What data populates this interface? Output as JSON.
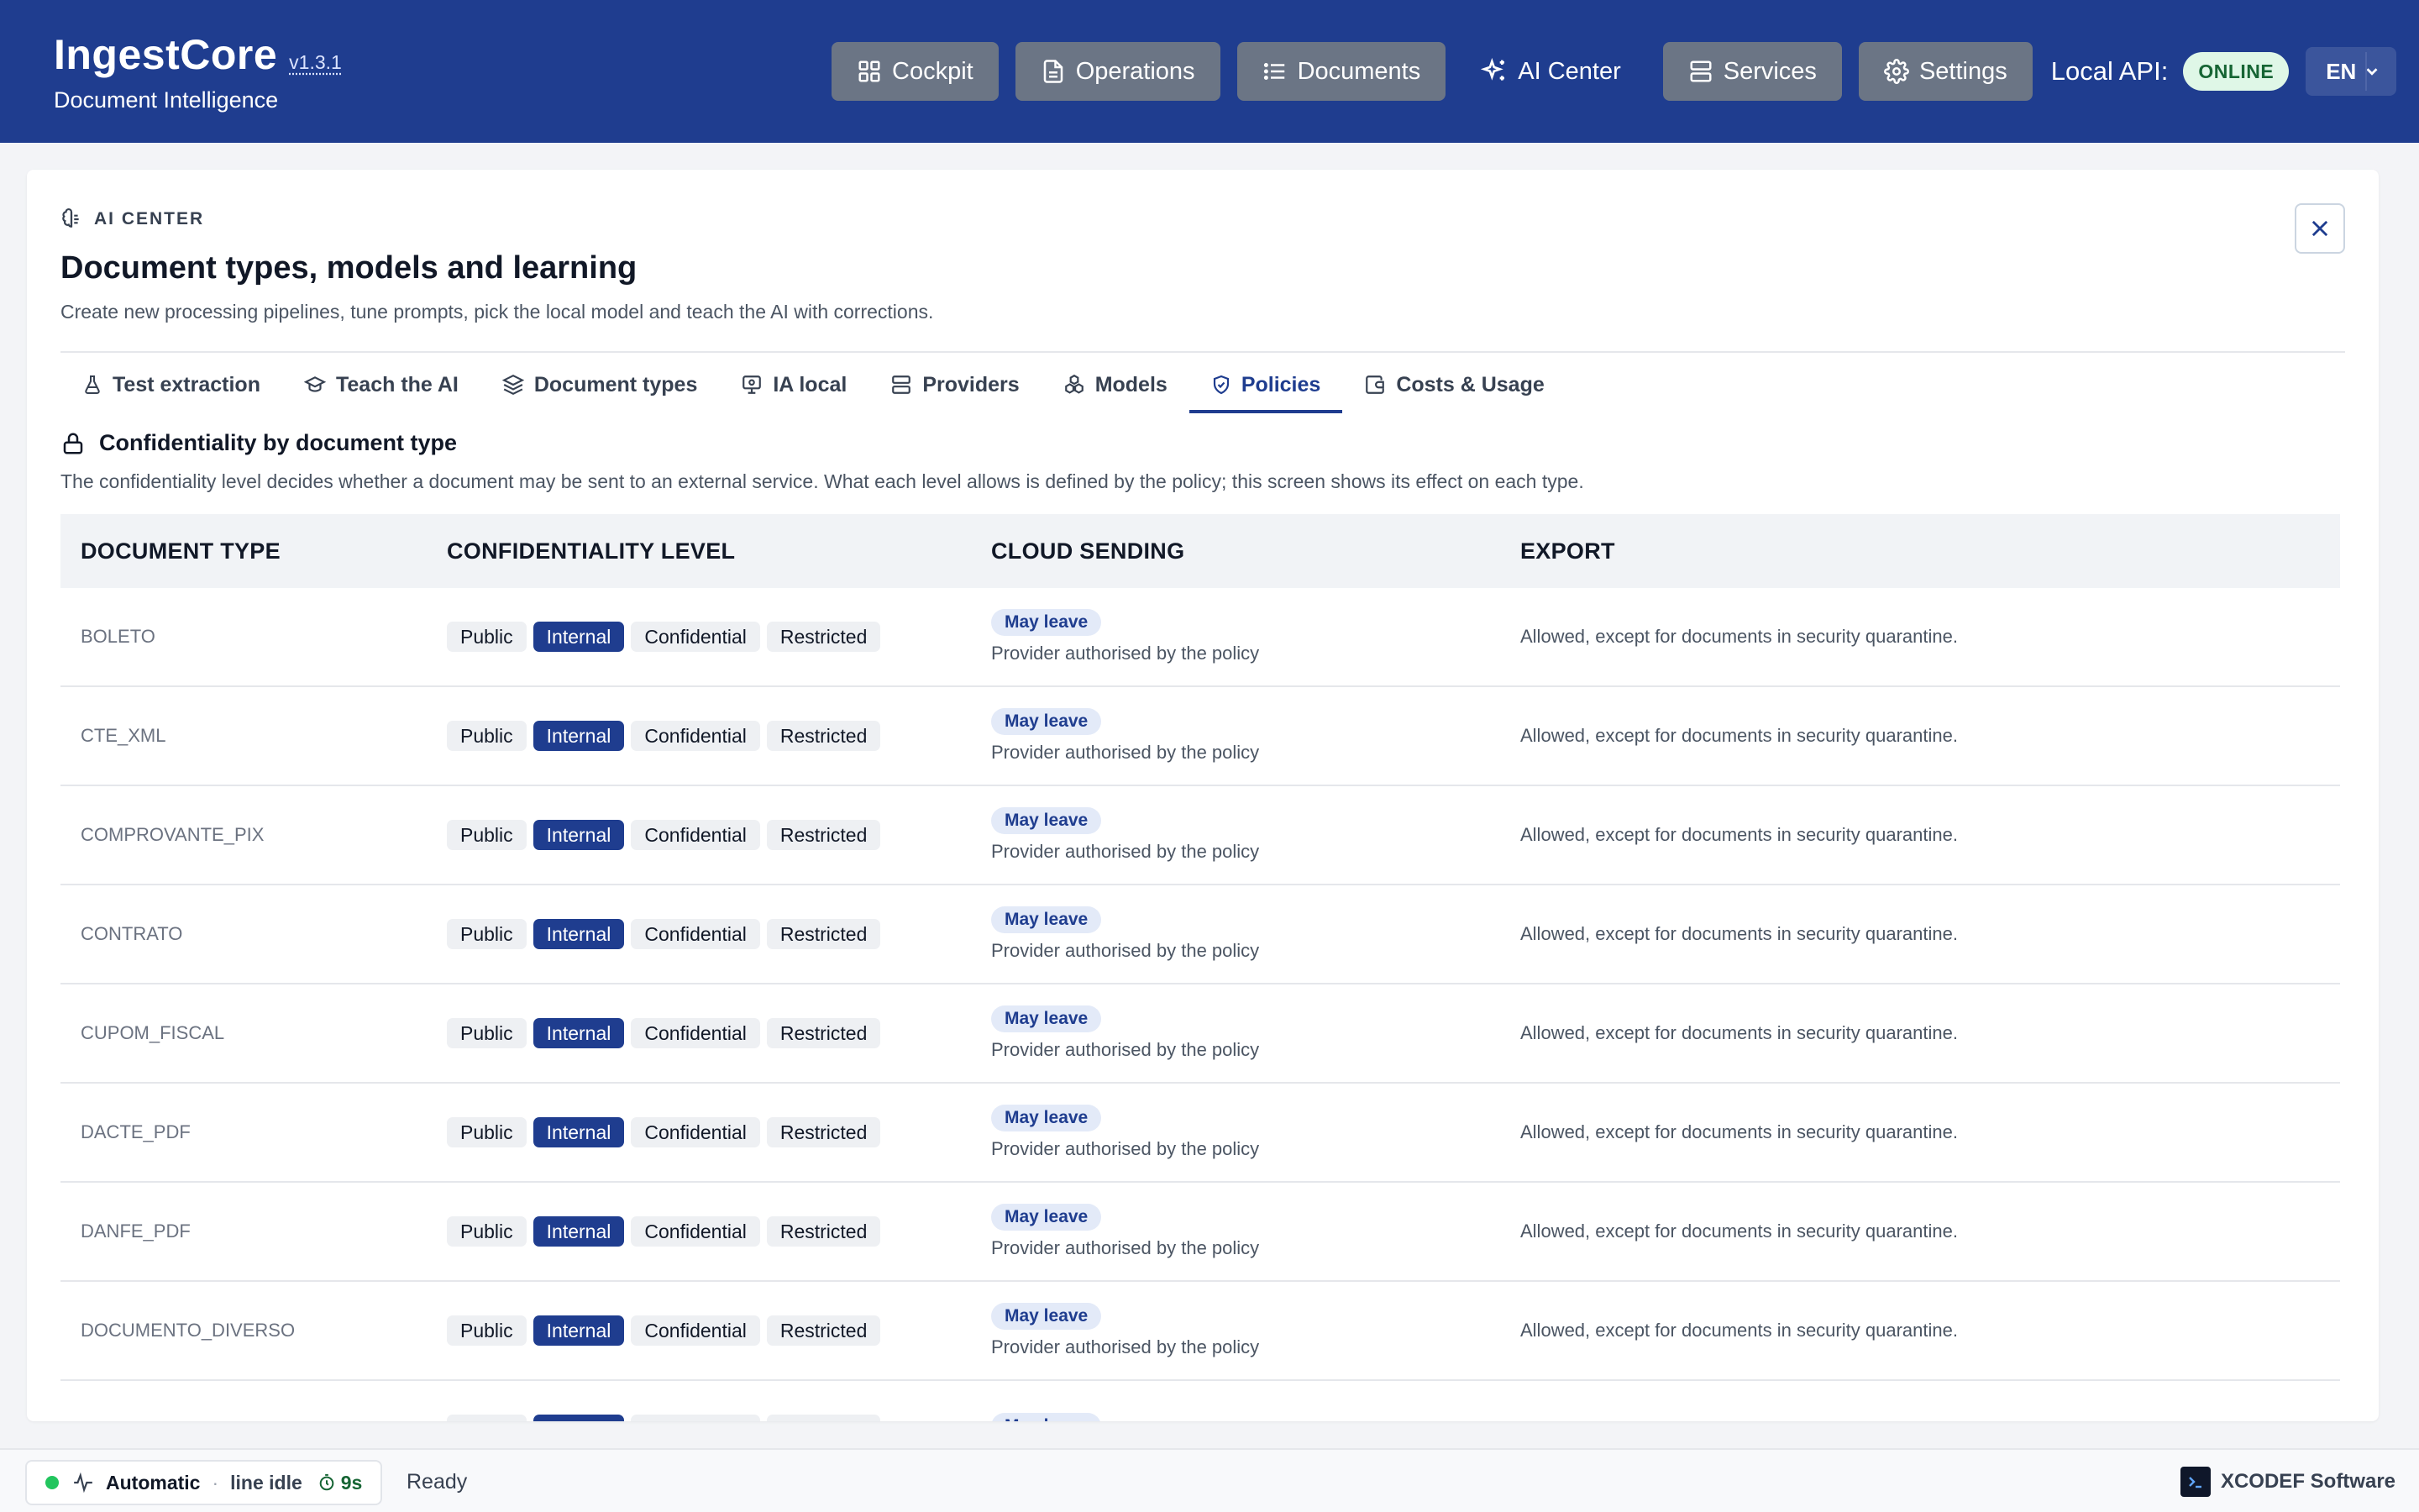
{
  "app": {
    "name": "IngestCore",
    "version": "v1.3.1",
    "subtitle": "Document Intelligence"
  },
  "nav": {
    "cockpit": "Cockpit",
    "operations": "Operations",
    "documents": "Documents",
    "ai_center": "AI Center",
    "services": "Services",
    "settings": "Settings",
    "api_label": "Local API:",
    "api_status": "ONLINE",
    "language": "EN"
  },
  "panel": {
    "eyebrow": "AI CENTER",
    "title": "Document types, models and learning",
    "description": "Create new processing pipelines, tune prompts, pick the local model and teach the AI with corrections."
  },
  "tabs": [
    {
      "label": "Test extraction",
      "icon": "flask-icon"
    },
    {
      "label": "Teach the AI",
      "icon": "graduation-cap-icon"
    },
    {
      "label": "Document types",
      "icon": "layers-icon"
    },
    {
      "label": "IA local",
      "icon": "monitor-brain-icon"
    },
    {
      "label": "Providers",
      "icon": "server-icon"
    },
    {
      "label": "Models",
      "icon": "boxes-icon"
    },
    {
      "label": "Policies",
      "icon": "shield-icon",
      "active": true
    },
    {
      "label": "Costs & Usage",
      "icon": "wallet-icon"
    }
  ],
  "section": {
    "title": "Confidentiality by document type",
    "description": "The confidentiality level decides whether a document may be sent to an external service. What each level allows is defined by the policy; this screen shows its effect on each type."
  },
  "table": {
    "headers": {
      "type": "DOCUMENT TYPE",
      "level": "CONFIDENTIALITY LEVEL",
      "cloud": "CLOUD SENDING",
      "export": "EXPORT"
    },
    "level_options": [
      "Public",
      "Internal",
      "Confidential",
      "Restricted"
    ],
    "rows": [
      {
        "type": "BOLETO",
        "level": "Internal",
        "cloud_badge": "May leave",
        "cloud_note": "Provider authorised by the policy",
        "export": "Allowed, except for documents in security quarantine."
      },
      {
        "type": "CTE_XML",
        "level": "Internal",
        "cloud_badge": "May leave",
        "cloud_note": "Provider authorised by the policy",
        "export": "Allowed, except for documents in security quarantine."
      },
      {
        "type": "COMPROVANTE_PIX",
        "level": "Internal",
        "cloud_badge": "May leave",
        "cloud_note": "Provider authorised by the policy",
        "export": "Allowed, except for documents in security quarantine."
      },
      {
        "type": "CONTRATO",
        "level": "Internal",
        "cloud_badge": "May leave",
        "cloud_note": "Provider authorised by the policy",
        "export": "Allowed, except for documents in security quarantine."
      },
      {
        "type": "CUPOM_FISCAL",
        "level": "Internal",
        "cloud_badge": "May leave",
        "cloud_note": "Provider authorised by the policy",
        "export": "Allowed, except for documents in security quarantine."
      },
      {
        "type": "DACTE_PDF",
        "level": "Internal",
        "cloud_badge": "May leave",
        "cloud_note": "Provider authorised by the policy",
        "export": "Allowed, except for documents in security quarantine."
      },
      {
        "type": "DANFE_PDF",
        "level": "Internal",
        "cloud_badge": "May leave",
        "cloud_note": "Provider authorised by the policy",
        "export": "Allowed, except for documents in security quarantine."
      },
      {
        "type": "DOCUMENTO_DIVERSO",
        "level": "Internal",
        "cloud_badge": "May leave",
        "cloud_note": "Provider authorised by the policy",
        "export": "Allowed, except for documents in security quarantine."
      },
      {
        "type": "",
        "level": "Internal",
        "cloud_badge": "May leave",
        "cloud_note": "",
        "export": ""
      }
    ]
  },
  "status": {
    "mode": "Automatic",
    "separator": "·",
    "line_state": "line idle",
    "timer": "9s",
    "state": "Ready",
    "vendor": "XCODEF Software"
  },
  "colors": {
    "brand": "#1f3d8f",
    "online_bg": "#dff7e7",
    "online_text": "#166534",
    "status_dot": "#22c55e"
  }
}
